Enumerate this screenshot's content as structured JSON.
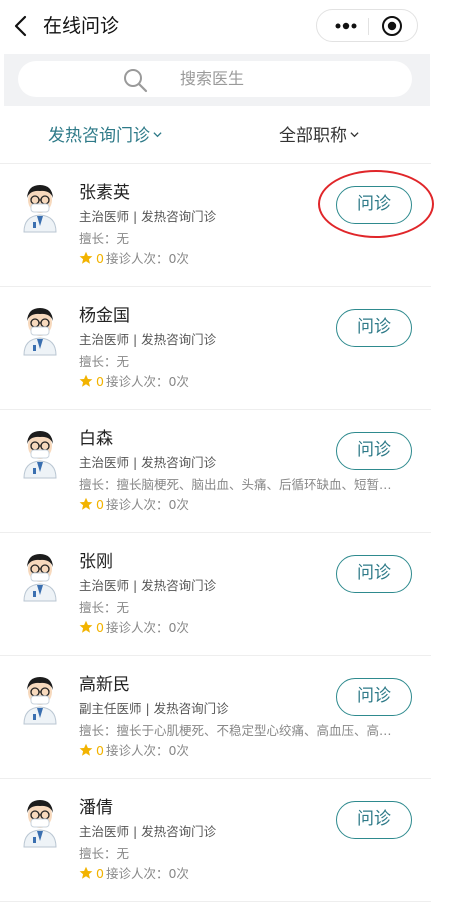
{
  "navbar": {
    "title": "在线问诊"
  },
  "search": {
    "placeholder": "搜索医生"
  },
  "filters": {
    "department": "发热咨询门诊",
    "title": "全部职称"
  },
  "labels": {
    "specialty_prefix": "擅长：",
    "consult_count_prefix": "接诊人次：",
    "consult_count_suffix": "次",
    "consult_button": "问诊"
  },
  "colors": {
    "accent": "#2e7a88",
    "star": "#f2b300",
    "highlight": "#e0262a"
  },
  "doctors": [
    {
      "name": "张素英",
      "info": "主治医师 | 发热咨询门诊",
      "specialty": "擅长：无",
      "rating": "0",
      "consults": "接诊人次：0次",
      "button": "问诊"
    },
    {
      "name": "杨金国",
      "info": "主治医师 | 发热咨询门诊",
      "specialty": "擅长：无",
      "rating": "0",
      "consults": "接诊人次：0次",
      "button": "问诊"
    },
    {
      "name": "白森",
      "info": "主治医师 | 发热咨询门诊",
      "specialty": "擅长：擅长脑梗死、脑出血、头痛、后循环缺血、短暂…",
      "rating": "0",
      "consults": "接诊人次：0次",
      "button": "问诊"
    },
    {
      "name": "张刚",
      "info": "主治医师 | 发热咨询门诊",
      "specialty": "擅长：无",
      "rating": "0",
      "consults": "接诊人次：0次",
      "button": "问诊"
    },
    {
      "name": "高新民",
      "info": "副主任医师 | 发热咨询门诊",
      "specialty": "擅长：擅长于心肌梗死、不稳定型心绞痛、高血压、高…",
      "rating": "0",
      "consults": "接诊人次：0次",
      "button": "问诊"
    },
    {
      "name": "潘倩",
      "info": "主治医师 | 发热咨询门诊",
      "specialty": "擅长：无",
      "rating": "0",
      "consults": "接诊人次：0次",
      "button": "问诊"
    }
  ],
  "icons": {
    "back": "chevron-left-icon",
    "more": "more-dots-icon",
    "target": "target-icon",
    "search": "search-icon",
    "star": "star-icon",
    "avatar": "doctor-avatar"
  }
}
